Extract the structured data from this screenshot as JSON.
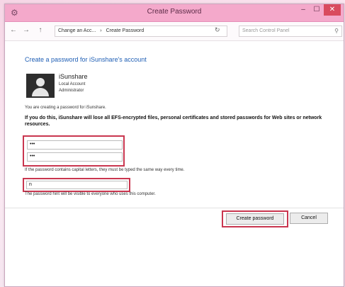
{
  "window": {
    "title": "Create Password",
    "controls": {
      "minimize": "–",
      "maximize": "☐",
      "close": "✕"
    }
  },
  "address_bar": {
    "back": "←",
    "forward": "→",
    "up": "↑",
    "breadcrumb": [
      "Change an Acc...",
      "Create Password"
    ],
    "refresh": "↻",
    "search_placeholder": "Search Control Panel"
  },
  "main": {
    "heading": "Create a password for iSunshare's account",
    "user": {
      "name": "iSunshare",
      "type": "Local Account",
      "role": "Administrator"
    },
    "creating_text": "You are creating a password for iSunshare.",
    "warning": "If you do this, iSunshare will lose all EFS-encrypted files, personal certificates and stored passwords for Web sites or network resources.",
    "password_value": "•••",
    "confirm_value": "•••",
    "capital_note": "If the password contains capital letters, they must be typed the same way every time.",
    "hint_value": "n",
    "hint_note": "The password hint will be visible to everyone who uses this computer.",
    "create_button": "Create password",
    "cancel_button": "Cancel"
  },
  "colors": {
    "accent": "#1f5fb5",
    "highlight": "#c9364f",
    "titlebar": "#f4a9cb"
  }
}
